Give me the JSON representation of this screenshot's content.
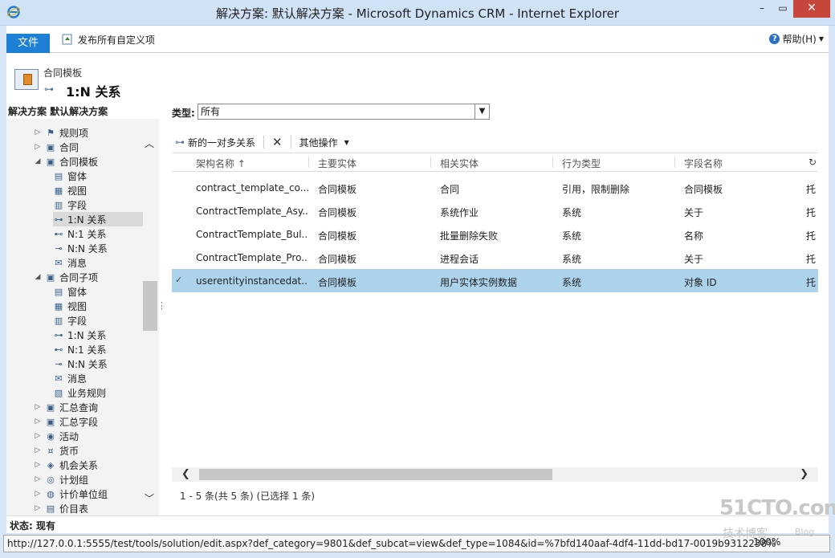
{
  "window": {
    "title": "解决方案: 默认解决方案 - Microsoft Dynamics CRM - Internet Explorer",
    "minimize": "–",
    "maximize": "▭",
    "close": "✕"
  },
  "ribbon": {
    "file_tab": "文件",
    "publish_all": "发布所有自定义项",
    "help": "帮助(H)"
  },
  "header": {
    "entity_name": "合同模板",
    "page_title": "1:N 关系"
  },
  "nav": {
    "title": "解决方案 默认解决方案",
    "items": [
      {
        "label": "规则项",
        "expander": "▷",
        "icon": "rule-icon",
        "glyph": "⚑"
      },
      {
        "label": "合同",
        "expander": "▷",
        "icon": "entity-icon",
        "glyph": "▣"
      },
      {
        "label": "合同模板",
        "expander": "◢",
        "icon": "entity-icon",
        "glyph": "▣"
      },
      {
        "label": "窗体",
        "expander": "",
        "icon": "form-icon",
        "glyph": "▤"
      },
      {
        "label": "视图",
        "expander": "",
        "icon": "view-icon",
        "glyph": "▦"
      },
      {
        "label": "字段",
        "expander": "",
        "icon": "field-icon",
        "glyph": "▥"
      },
      {
        "label": "1:N 关系",
        "expander": "",
        "icon": "relationship-icon",
        "glyph": "⊶"
      },
      {
        "label": "N:1 关系",
        "expander": "",
        "icon": "relationship-icon",
        "glyph": "⊷"
      },
      {
        "label": "N:N 关系",
        "expander": "",
        "icon": "relationship-icon",
        "glyph": "⊸"
      },
      {
        "label": "消息",
        "expander": "",
        "icon": "message-icon",
        "glyph": "✉"
      },
      {
        "label": "合同子项",
        "expander": "◢",
        "icon": "entity-icon",
        "glyph": "▣"
      },
      {
        "label": "窗体",
        "expander": "",
        "icon": "form-icon",
        "glyph": "▤"
      },
      {
        "label": "视图",
        "expander": "",
        "icon": "view-icon",
        "glyph": "▦"
      },
      {
        "label": "字段",
        "expander": "",
        "icon": "field-icon",
        "glyph": "▥"
      },
      {
        "label": "1:N 关系",
        "expander": "",
        "icon": "relationship-icon",
        "glyph": "⊶"
      },
      {
        "label": "N:1 关系",
        "expander": "",
        "icon": "relationship-icon",
        "glyph": "⊷"
      },
      {
        "label": "N:N 关系",
        "expander": "",
        "icon": "relationship-icon",
        "glyph": "⊸"
      },
      {
        "label": "消息",
        "expander": "",
        "icon": "message-icon",
        "glyph": "✉"
      },
      {
        "label": "业务规则",
        "expander": "",
        "icon": "business-rule-icon",
        "glyph": "▧"
      },
      {
        "label": "汇总查询",
        "expander": "▷",
        "icon": "entity-icon",
        "glyph": "▣"
      },
      {
        "label": "汇总字段",
        "expander": "▷",
        "icon": "entity-icon",
        "glyph": "▣"
      },
      {
        "label": "活动",
        "expander": "▷",
        "icon": "activity-icon",
        "glyph": "◉"
      },
      {
        "label": "货币",
        "expander": "▷",
        "icon": "currency-icon",
        "glyph": "¤"
      },
      {
        "label": "机会关系",
        "expander": "▷",
        "icon": "opportunity-icon",
        "glyph": "◈"
      },
      {
        "label": "计划组",
        "expander": "▷",
        "icon": "plan-group-icon",
        "glyph": "◎"
      },
      {
        "label": "计价单位组",
        "expander": "▷",
        "icon": "unit-group-icon",
        "glyph": "◍"
      },
      {
        "label": "价目表",
        "expander": "▷",
        "icon": "pricelist-icon",
        "glyph": "▤"
      }
    ]
  },
  "filter": {
    "label": "类型:",
    "value": "所有"
  },
  "toolbar": {
    "new_label": "新的一对多关系",
    "more_label": "其他操作"
  },
  "grid": {
    "columns": [
      "架构名称 ↑",
      "主要实体",
      "相关实体",
      "行为类型",
      "字段名称"
    ],
    "rows": [
      {
        "schema": "contract_template_co...",
        "primary": "合同模板",
        "related": "合同",
        "behavior": "引用，限制删除",
        "field": "合同模板",
        "extra": "托",
        "selected": false
      },
      {
        "schema": "ContractTemplate_Asy...",
        "primary": "合同模板",
        "related": "系统作业",
        "behavior": "系统",
        "field": "关于",
        "extra": "托",
        "selected": false
      },
      {
        "schema": "ContractTemplate_Bul...",
        "primary": "合同模板",
        "related": "批量删除失败",
        "behavior": "系统",
        "field": "名称",
        "extra": "托",
        "selected": false
      },
      {
        "schema": "ContractTemplate_Pro...",
        "primary": "合同模板",
        "related": "进程会话",
        "behavior": "系统",
        "field": "关于",
        "extra": "托",
        "selected": false
      },
      {
        "schema": "userentityinstancedat...",
        "primary": "合同模板",
        "related": "用户实体实例数据",
        "behavior": "系统",
        "field": "对象 ID",
        "extra": "托",
        "selected": true
      }
    ],
    "record_info": "1 - 5 条(共 5 条) (已选择 1 条)"
  },
  "status": {
    "label": "状态: 现有"
  },
  "address": {
    "url": "http://127.0.0.1:5555/test/tools/solution/edit.aspx?def_category=9801&def_subcat=view&def_type=1084&id=%7bfd140aaf-4df4-11dd-bd17-0019b9312238%",
    "zoom": "100%"
  },
  "watermark": {
    "line1": "51CTO.com",
    "line2": "技术博客",
    "line3": "Blog"
  },
  "colors": {
    "accent": "#1e7fd6",
    "selected_row": "#add3ec",
    "close_button": "#c7463b"
  }
}
